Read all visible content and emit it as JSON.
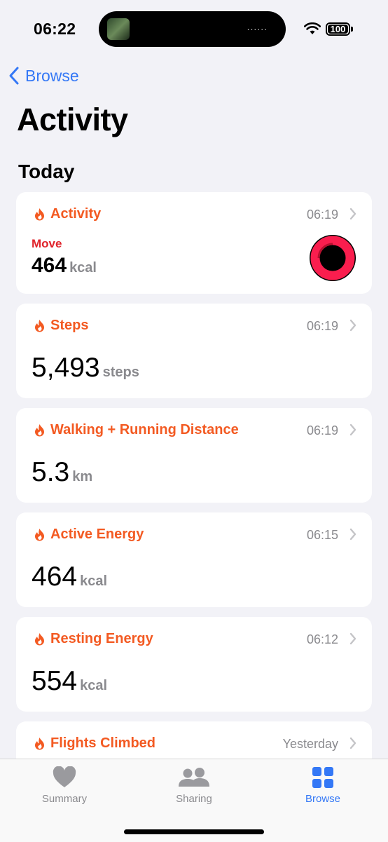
{
  "status": {
    "time": "06:22",
    "battery": "100",
    "island_dots": "......"
  },
  "nav": {
    "back_label": "Browse"
  },
  "page": {
    "title": "Activity",
    "section": "Today"
  },
  "cards": [
    {
      "title": "Activity",
      "time": "06:19",
      "sub_label": "Move",
      "value": "464",
      "unit": "kcal"
    },
    {
      "title": "Steps",
      "time": "06:19",
      "value": "5,493",
      "unit": "steps"
    },
    {
      "title": "Walking + Running Distance",
      "time": "06:19",
      "value": "5.3",
      "unit": "km"
    },
    {
      "title": "Active Energy",
      "time": "06:15",
      "value": "464",
      "unit": "kcal"
    },
    {
      "title": "Resting Energy",
      "time": "06:12",
      "value": "554",
      "unit": "kcal"
    },
    {
      "title": "Flights Climbed",
      "time": "Yesterday"
    }
  ],
  "tabs": [
    {
      "label": "Summary",
      "icon": "heart-icon"
    },
    {
      "label": "Sharing",
      "icon": "people-icon"
    },
    {
      "label": "Browse",
      "icon": "grid-icon",
      "active": true
    }
  ],
  "colors": {
    "accent": "#3478f6",
    "category": "#f35a22",
    "move": "#e0242c",
    "background": "#f2f2f7"
  }
}
